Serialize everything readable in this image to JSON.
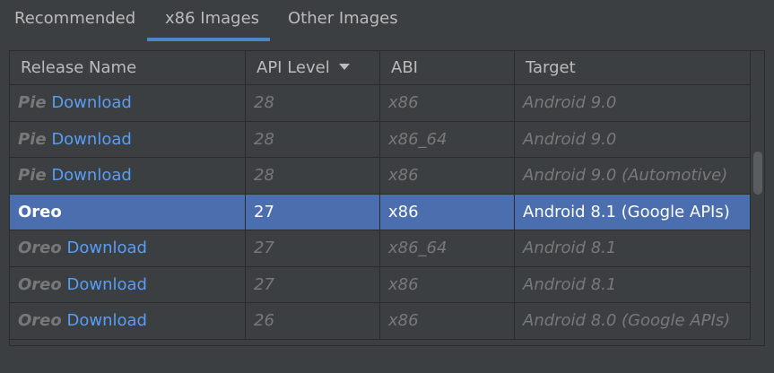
{
  "tabs": [
    {
      "label": "Recommended",
      "active": false
    },
    {
      "label": "x86 Images",
      "active": true
    },
    {
      "label": "Other Images",
      "active": false
    }
  ],
  "table": {
    "columns": [
      "Release Name",
      "API Level",
      "ABI",
      "Target"
    ],
    "sort_column": "API Level",
    "sort_direction": "descending",
    "rows": [
      {
        "release": "Pie",
        "download": "Download",
        "api": "28",
        "abi": "x86",
        "target": "Android 9.0",
        "selected": false
      },
      {
        "release": "Pie",
        "download": "Download",
        "api": "28",
        "abi": "x86_64",
        "target": "Android 9.0",
        "selected": false
      },
      {
        "release": "Pie",
        "download": "Download",
        "api": "28",
        "abi": "x86",
        "target": "Android 9.0 (Automotive)",
        "selected": false
      },
      {
        "release": "Oreo",
        "download": "",
        "api": "27",
        "abi": "x86",
        "target": "Android 8.1 (Google APIs)",
        "selected": true
      },
      {
        "release": "Oreo",
        "download": "Download",
        "api": "27",
        "abi": "x86_64",
        "target": "Android 8.1",
        "selected": false
      },
      {
        "release": "Oreo",
        "download": "Download",
        "api": "27",
        "abi": "x86",
        "target": "Android 8.1",
        "selected": false
      },
      {
        "release": "Oreo",
        "download": "Download",
        "api": "26",
        "abi": "x86",
        "target": "Android 8.0 (Google APIs)",
        "selected": false
      }
    ]
  },
  "colors": {
    "background": "#3c3f41",
    "selection": "#4b6eaf",
    "link": "#589df6",
    "tab_underline": "#4a88c7"
  }
}
